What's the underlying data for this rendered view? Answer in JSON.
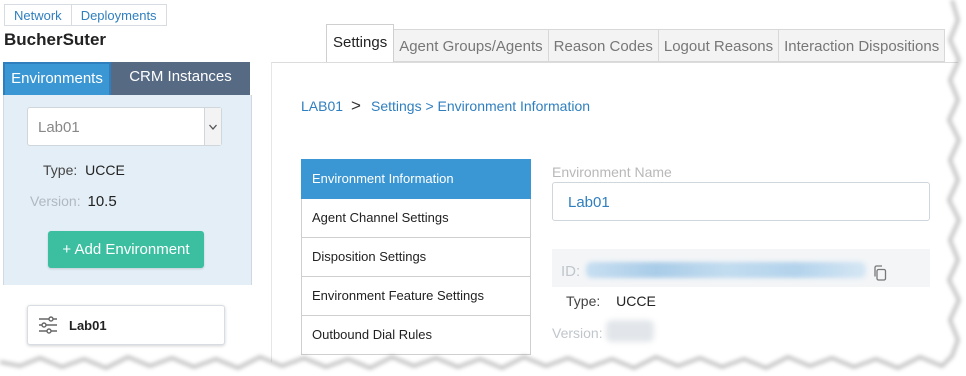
{
  "top_nav": {
    "items": [
      "Network",
      "Deployments"
    ]
  },
  "company_name": "BucherSuter",
  "left_panel": {
    "tabs": [
      "Environments",
      "CRM Instances"
    ],
    "environment_select": {
      "value": "Lab01"
    },
    "type_label": "Type:",
    "type_value": "UCCE",
    "version_label": "Version:",
    "version_value": "10.5",
    "add_button": "+ Add Environment",
    "environment_card": {
      "label": "Lab01",
      "icon": "sliders-icon"
    }
  },
  "main_tabs": [
    "Settings",
    "Agent Groups/Agents",
    "Reason Codes",
    "Logout Reasons",
    "Interaction Dispositions"
  ],
  "breadcrumb": {
    "root": "LAB01",
    "separator": ">",
    "path": "Settings > Environment Information"
  },
  "settings_menu": [
    "Environment Information",
    "Agent Channel Settings",
    "Disposition Settings",
    "Environment Feature Settings",
    "Outbound Dial Rules"
  ],
  "details": {
    "name_label": "Environment Name",
    "name_value": "Lab01",
    "id_label": "ID:",
    "type_label": "Type:",
    "type_value": "UCCE",
    "version_label": "Version:"
  },
  "colors": {
    "accent": "#3a97d4",
    "add_button": "#3bbfa0",
    "inactive_tab": "#566a84"
  }
}
